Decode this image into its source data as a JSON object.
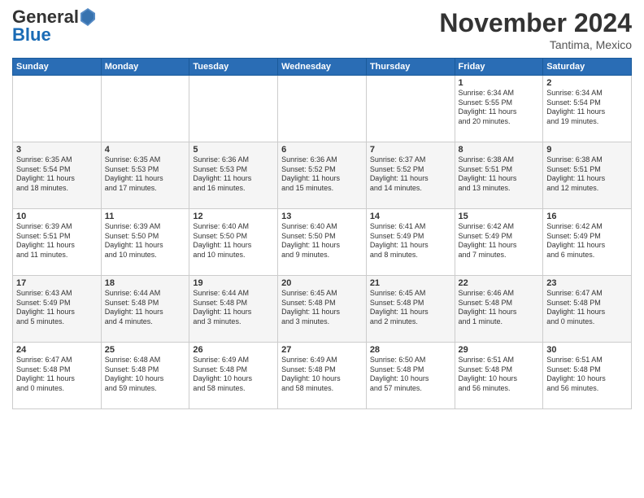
{
  "header": {
    "logo_general": "General",
    "logo_blue": "Blue",
    "month_title": "November 2024",
    "location": "Tantima, Mexico"
  },
  "weekdays": [
    "Sunday",
    "Monday",
    "Tuesday",
    "Wednesday",
    "Thursday",
    "Friday",
    "Saturday"
  ],
  "weeks": [
    [
      {
        "day": "",
        "info": ""
      },
      {
        "day": "",
        "info": ""
      },
      {
        "day": "",
        "info": ""
      },
      {
        "day": "",
        "info": ""
      },
      {
        "day": "",
        "info": ""
      },
      {
        "day": "1",
        "info": "Sunrise: 6:34 AM\nSunset: 5:55 PM\nDaylight: 11 hours\nand 20 minutes."
      },
      {
        "day": "2",
        "info": "Sunrise: 6:34 AM\nSunset: 5:54 PM\nDaylight: 11 hours\nand 19 minutes."
      }
    ],
    [
      {
        "day": "3",
        "info": "Sunrise: 6:35 AM\nSunset: 5:54 PM\nDaylight: 11 hours\nand 18 minutes."
      },
      {
        "day": "4",
        "info": "Sunrise: 6:35 AM\nSunset: 5:53 PM\nDaylight: 11 hours\nand 17 minutes."
      },
      {
        "day": "5",
        "info": "Sunrise: 6:36 AM\nSunset: 5:53 PM\nDaylight: 11 hours\nand 16 minutes."
      },
      {
        "day": "6",
        "info": "Sunrise: 6:36 AM\nSunset: 5:52 PM\nDaylight: 11 hours\nand 15 minutes."
      },
      {
        "day": "7",
        "info": "Sunrise: 6:37 AM\nSunset: 5:52 PM\nDaylight: 11 hours\nand 14 minutes."
      },
      {
        "day": "8",
        "info": "Sunrise: 6:38 AM\nSunset: 5:51 PM\nDaylight: 11 hours\nand 13 minutes."
      },
      {
        "day": "9",
        "info": "Sunrise: 6:38 AM\nSunset: 5:51 PM\nDaylight: 11 hours\nand 12 minutes."
      }
    ],
    [
      {
        "day": "10",
        "info": "Sunrise: 6:39 AM\nSunset: 5:51 PM\nDaylight: 11 hours\nand 11 minutes."
      },
      {
        "day": "11",
        "info": "Sunrise: 6:39 AM\nSunset: 5:50 PM\nDaylight: 11 hours\nand 10 minutes."
      },
      {
        "day": "12",
        "info": "Sunrise: 6:40 AM\nSunset: 5:50 PM\nDaylight: 11 hours\nand 10 minutes."
      },
      {
        "day": "13",
        "info": "Sunrise: 6:40 AM\nSunset: 5:50 PM\nDaylight: 11 hours\nand 9 minutes."
      },
      {
        "day": "14",
        "info": "Sunrise: 6:41 AM\nSunset: 5:49 PM\nDaylight: 11 hours\nand 8 minutes."
      },
      {
        "day": "15",
        "info": "Sunrise: 6:42 AM\nSunset: 5:49 PM\nDaylight: 11 hours\nand 7 minutes."
      },
      {
        "day": "16",
        "info": "Sunrise: 6:42 AM\nSunset: 5:49 PM\nDaylight: 11 hours\nand 6 minutes."
      }
    ],
    [
      {
        "day": "17",
        "info": "Sunrise: 6:43 AM\nSunset: 5:49 PM\nDaylight: 11 hours\nand 5 minutes."
      },
      {
        "day": "18",
        "info": "Sunrise: 6:44 AM\nSunset: 5:48 PM\nDaylight: 11 hours\nand 4 minutes."
      },
      {
        "day": "19",
        "info": "Sunrise: 6:44 AM\nSunset: 5:48 PM\nDaylight: 11 hours\nand 3 minutes."
      },
      {
        "day": "20",
        "info": "Sunrise: 6:45 AM\nSunset: 5:48 PM\nDaylight: 11 hours\nand 3 minutes."
      },
      {
        "day": "21",
        "info": "Sunrise: 6:45 AM\nSunset: 5:48 PM\nDaylight: 11 hours\nand 2 minutes."
      },
      {
        "day": "22",
        "info": "Sunrise: 6:46 AM\nSunset: 5:48 PM\nDaylight: 11 hours\nand 1 minute."
      },
      {
        "day": "23",
        "info": "Sunrise: 6:47 AM\nSunset: 5:48 PM\nDaylight: 11 hours\nand 0 minutes."
      }
    ],
    [
      {
        "day": "24",
        "info": "Sunrise: 6:47 AM\nSunset: 5:48 PM\nDaylight: 11 hours\nand 0 minutes."
      },
      {
        "day": "25",
        "info": "Sunrise: 6:48 AM\nSunset: 5:48 PM\nDaylight: 10 hours\nand 59 minutes."
      },
      {
        "day": "26",
        "info": "Sunrise: 6:49 AM\nSunset: 5:48 PM\nDaylight: 10 hours\nand 58 minutes."
      },
      {
        "day": "27",
        "info": "Sunrise: 6:49 AM\nSunset: 5:48 PM\nDaylight: 10 hours\nand 58 minutes."
      },
      {
        "day": "28",
        "info": "Sunrise: 6:50 AM\nSunset: 5:48 PM\nDaylight: 10 hours\nand 57 minutes."
      },
      {
        "day": "29",
        "info": "Sunrise: 6:51 AM\nSunset: 5:48 PM\nDaylight: 10 hours\nand 56 minutes."
      },
      {
        "day": "30",
        "info": "Sunrise: 6:51 AM\nSunset: 5:48 PM\nDaylight: 10 hours\nand 56 minutes."
      }
    ]
  ]
}
